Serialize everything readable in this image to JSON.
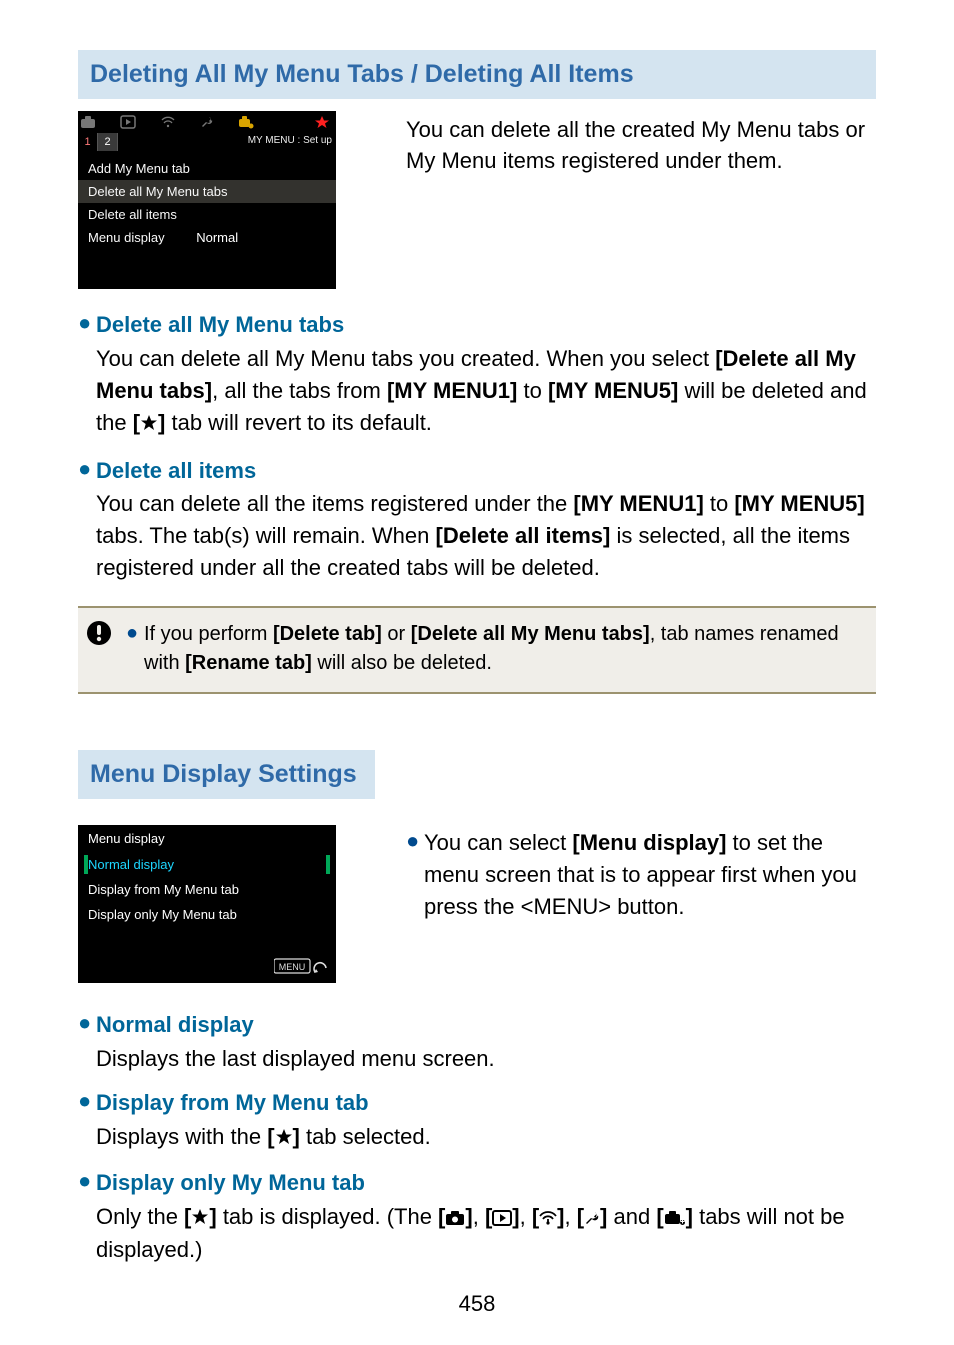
{
  "page_number": "458",
  "section1": {
    "header": "Deleting All My Menu Tabs / Deleting All Items",
    "camera": {
      "tab1": "1",
      "tab2": "2",
      "tabs_label": "MY MENU : Set up",
      "row_add": "Add My Menu tab",
      "row_del_tabs": "Delete all My Menu tabs",
      "row_del_items": "Delete all items",
      "row_disp_label": "Menu display",
      "row_disp_value": "Normal"
    },
    "intro": "You can delete all the created My Menu tabs or My Menu items registered under them.",
    "b1_title": "Delete all My Menu tabs",
    "b1_pre": "You can delete all My Menu tabs you created. When you select ",
    "b1_bold1": "[Delete all My Menu tabs]",
    "b1_mid": ", all the tabs from ",
    "b1_bold2": "[MY MENU1]",
    "b1_mid2": " to ",
    "b1_bold3": "[MY MENU5]",
    "b1_mid3": " will be deleted and the ",
    "b1_bold4_open": "[",
    "b1_bold4_close": "]",
    "b1_end": " tab will revert to its default.",
    "b2_title": "Delete all items",
    "b2_pre": "You can delete all the items registered under the ",
    "b2_bold1": "[MY MENU1]",
    "b2_mid": " to ",
    "b2_bold2": "[MY MENU5]",
    "b2_mid2": " tabs. The tab(s) will remain. When ",
    "b2_bold3": "[Delete all items]",
    "b2_end": " is selected, all the items registered under all the created tabs will be deleted.",
    "warn_pre": "If you perform ",
    "warn_bold1": "[Delete tab]",
    "warn_mid": " or ",
    "warn_bold2": "[Delete all My Menu tabs]",
    "warn_mid2": ", tab names renamed with ",
    "warn_bold3": "[Rename tab]",
    "warn_end": " will also be deleted."
  },
  "section2": {
    "header": "Menu Display Settings",
    "camera": {
      "title": "Menu display",
      "opt1": "Normal display",
      "opt2": "Display from My Menu tab",
      "opt3": "Display only My Menu tab"
    },
    "intro_pre": "You can select ",
    "intro_bold": "[Menu display]",
    "intro_mid": " to set the menu screen that is to appear first when you press the <",
    "intro_menu": "MENU",
    "intro_end": "> button.",
    "b1_title": "Normal display",
    "b1_body": "Displays the last displayed menu screen.",
    "b2_title": "Display from My Menu tab",
    "b2_pre": "Displays with the ",
    "b2_bold_open": "[",
    "b2_bold_close": "]",
    "b2_end": " tab selected.",
    "b3_title": "Display only My Menu tab",
    "b3_pre": "Only the ",
    "b3_mid": " tab is displayed. (The ",
    "b3_comma": ", ",
    "b3_and": " and ",
    "b3_end": " tabs will not be displayed.)"
  }
}
